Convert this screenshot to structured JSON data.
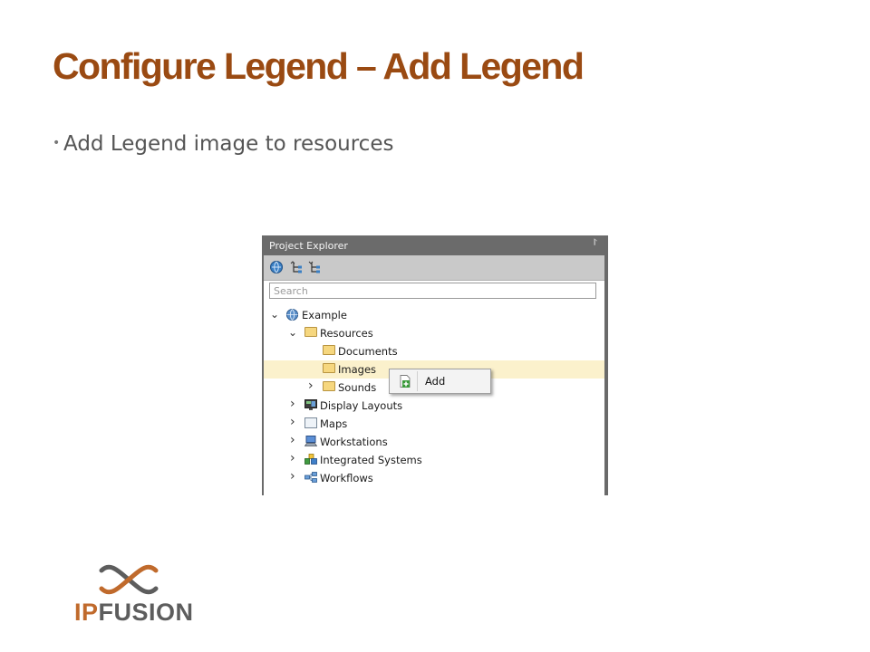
{
  "slide": {
    "title": "Configure Legend – Add Legend",
    "bullet": "Add Legend image to resources"
  },
  "panel": {
    "title": "Project Explorer",
    "pin_glyph": "⨡",
    "search_placeholder": "Search",
    "toolbar_icons": [
      "globe-refresh-icon",
      "collapse-tree-icon",
      "expand-tree-icon"
    ],
    "tree": [
      {
        "label": "Example",
        "icon": "globe-icon",
        "caret": "⌄"
      },
      {
        "label": "Resources",
        "icon": "folder-icon",
        "caret": "⌄"
      },
      {
        "label": "Documents",
        "icon": "folder-icon",
        "caret": ""
      },
      {
        "label": "Images",
        "icon": "folder-icon",
        "caret": "",
        "selected": true
      },
      {
        "label": "Sounds",
        "icon": "folder-icon",
        "caret": "›"
      },
      {
        "label": "Display Layouts",
        "icon": "display-layout-icon",
        "caret": "›"
      },
      {
        "label": "Maps",
        "icon": "map-icon",
        "caret": "›"
      },
      {
        "label": "Workstations",
        "icon": "workstation-icon",
        "caret": "›"
      },
      {
        "label": "Integrated Systems",
        "icon": "integrated-systems-icon",
        "caret": "›"
      },
      {
        "label": "Workflows",
        "icon": "workflow-icon",
        "caret": "›"
      }
    ]
  },
  "context_menu": {
    "add_label": "Add",
    "add_icon": "add-document-icon"
  },
  "logo": {
    "ip": "IP",
    "fusion": "FUSION"
  },
  "colors": {
    "title": "#9a4a12",
    "bullet_text": "#555555",
    "panel_header": "#6b6b6b",
    "toolbar": "#c9c9c9",
    "selected_row": "#fbf1cc",
    "logo_orange": "#c06a2c",
    "logo_gray": "#5d5d5d"
  }
}
